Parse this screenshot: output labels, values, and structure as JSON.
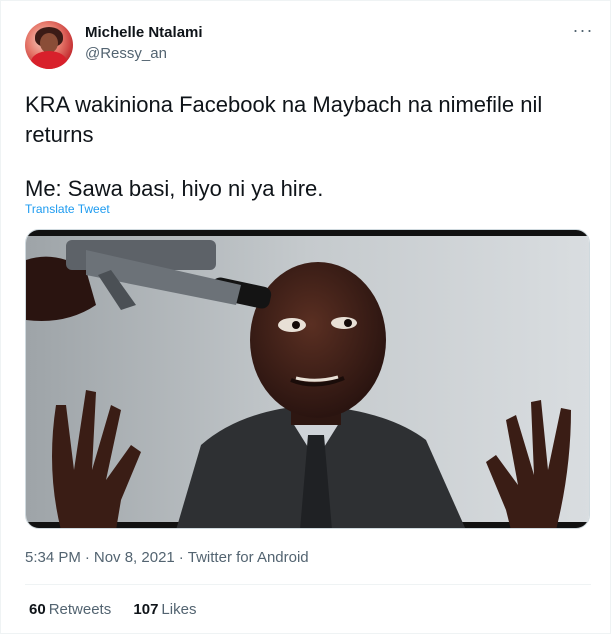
{
  "author": {
    "name": "Michelle Ntalami",
    "handle": "@Ressy_an",
    "avatar_icon": "profile-avatar"
  },
  "menu": {
    "more_label": "···"
  },
  "tweet": {
    "line1": "KRA wakiniona Facebook na Maybach na nimefile nil",
    "line2": "returns",
    "line3": "Me: Sawa basi, hiyo ni ya hire.",
    "translate_label": "Translate Tweet"
  },
  "media": {
    "kind": "photo",
    "description_icon": "meme-photo"
  },
  "meta": {
    "time": "5:34 PM",
    "date": "Nov 8, 2021",
    "client": "Twitter for Android",
    "separator": "·"
  },
  "stats": {
    "retweets_count": "60",
    "retweets_label": "Retweets",
    "likes_count": "107",
    "likes_label": "Likes"
  },
  "colors": {
    "link_blue": "#1d9bf0",
    "secondary_text": "#536471",
    "primary_text": "#0f1419",
    "divider": "#eff3f4"
  }
}
